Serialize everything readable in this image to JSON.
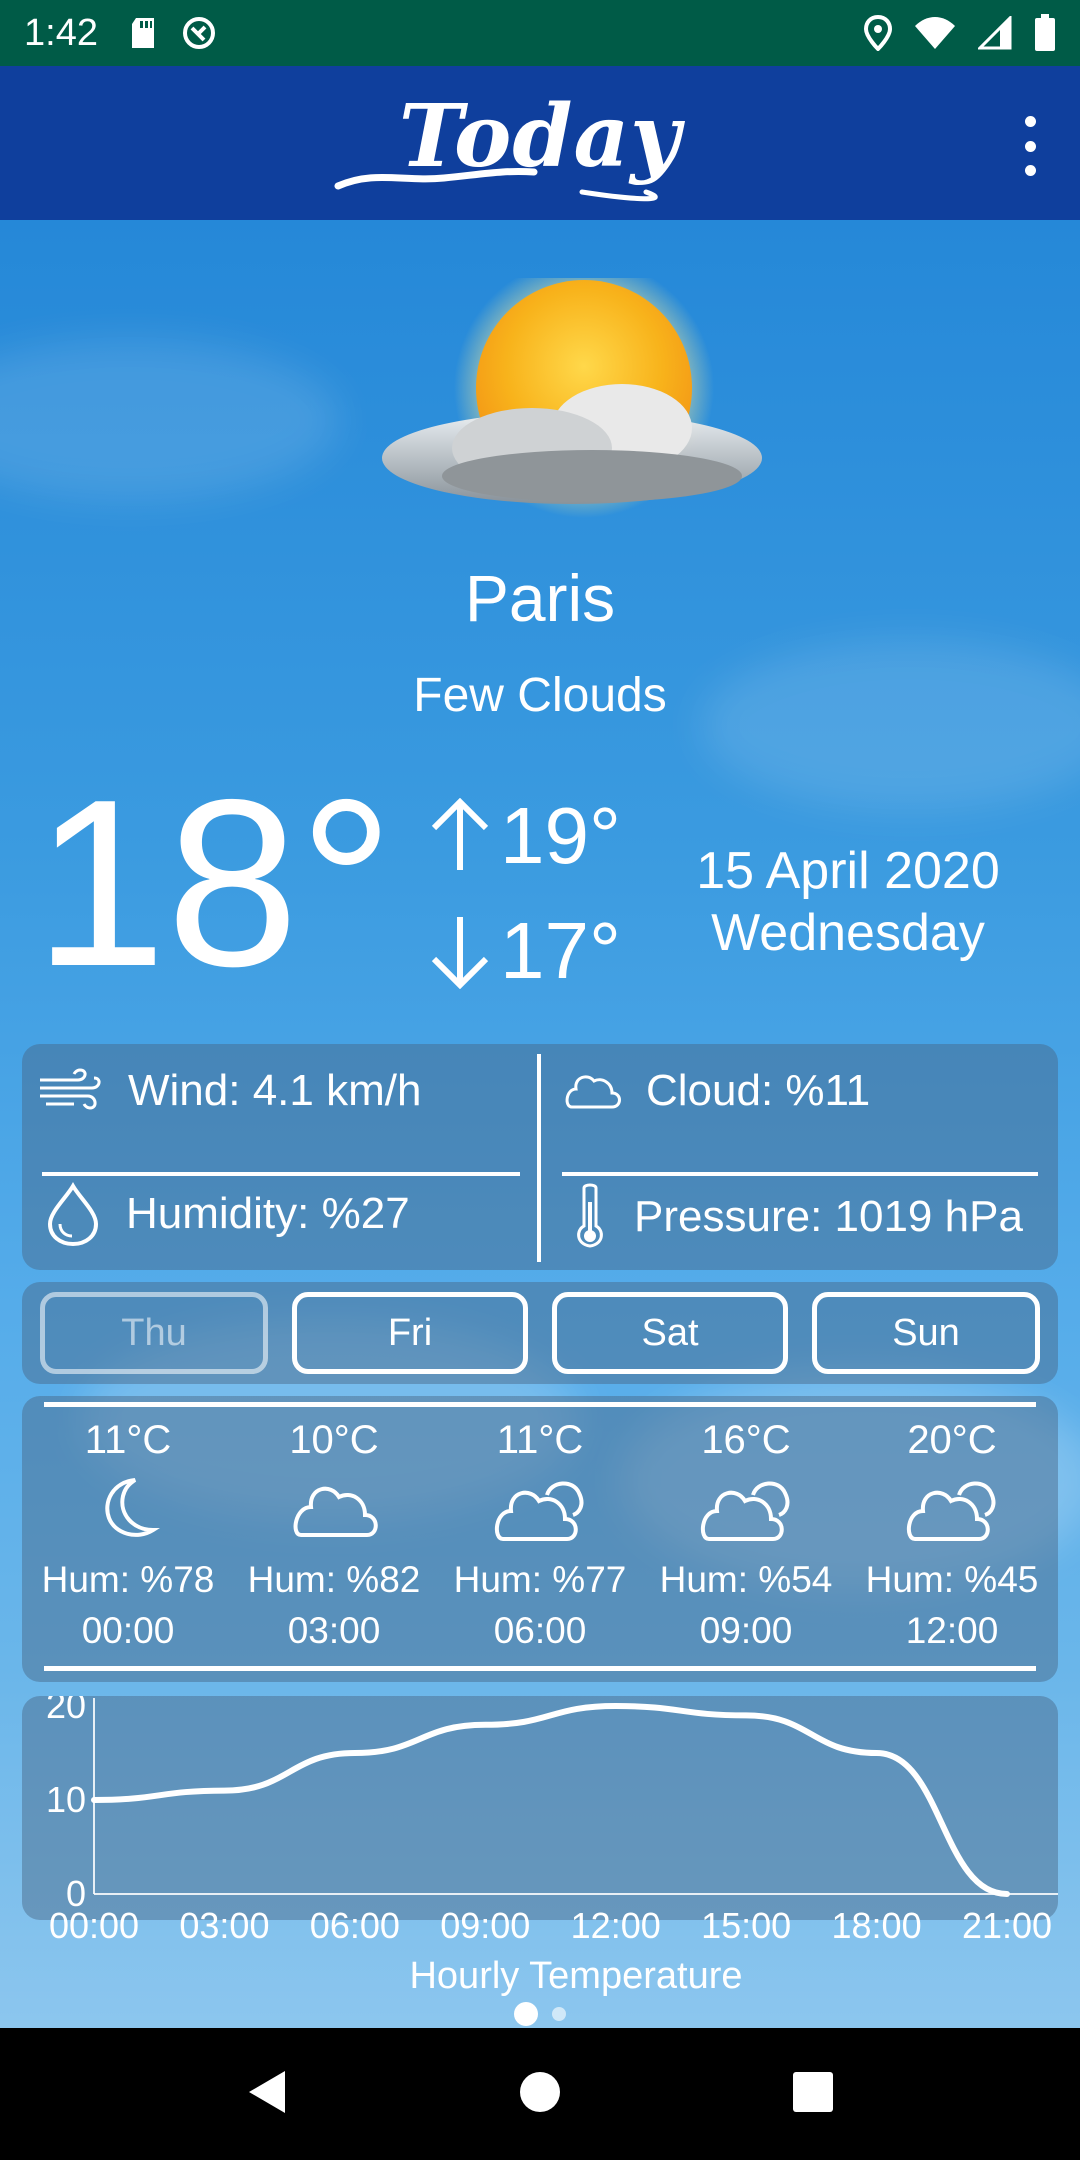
{
  "status_bar": {
    "time": "1:42",
    "left_icons": [
      "sd-card-icon",
      "data-saver-icon"
    ],
    "right_icons": [
      "location-icon",
      "wifi-icon",
      "signal-icon",
      "battery-icon"
    ]
  },
  "app_bar": {
    "title": "Today",
    "menu_icon": "more-vert-icon"
  },
  "current": {
    "city": "Paris",
    "condition": "Few Clouds",
    "temperature": "18°",
    "high": "19°",
    "low": "17°",
    "date": "15 April 2020",
    "weekday": "Wednesday",
    "icon": "sun-cloud-icon"
  },
  "details": {
    "wind": "Wind: 4.1 km/h",
    "cloud": "Cloud:  %11",
    "humidity": "Humidity:  %27",
    "pressure": "Pressure: 1019 hPa"
  },
  "days": [
    {
      "label": "Thu",
      "active": true
    },
    {
      "label": "Fri",
      "active": false
    },
    {
      "label": "Sat",
      "active": false
    },
    {
      "label": "Sun",
      "active": false
    }
  ],
  "hourly": [
    {
      "temp": "11°C",
      "icon": "moon-icon",
      "hum": "Hum: %78",
      "time": "00:00"
    },
    {
      "temp": "10°C",
      "icon": "cloud-icon",
      "hum": "Hum: %82",
      "time": "03:00"
    },
    {
      "temp": "11°C",
      "icon": "cloudy-icon",
      "hum": "Hum: %77",
      "time": "06:00"
    },
    {
      "temp": "16°C",
      "icon": "cloudy-icon",
      "hum": "Hum: %54",
      "time": "09:00"
    },
    {
      "temp": "20°C",
      "icon": "cloudy-icon",
      "hum": "Hum: %45",
      "time": "12:00"
    }
  ],
  "chart_data": {
    "type": "line",
    "title": "Hourly Temperature",
    "xlabel": "",
    "ylabel": "",
    "x": [
      "00:00",
      "03:00",
      "06:00",
      "09:00",
      "12:00",
      "15:00",
      "18:00",
      "21:00"
    ],
    "series": [
      {
        "values": [
          10,
          11,
          15,
          18,
          20,
          19,
          15,
          0
        ]
      }
    ],
    "yticks": [
      0,
      10,
      20
    ],
    "ylim": [
      0,
      20
    ],
    "grid": false,
    "color": "#ffffff"
  },
  "pager": {
    "pages": 2,
    "current": 0
  },
  "nav": {
    "back": "back-icon",
    "home": "home-icon",
    "recents": "recents-icon"
  }
}
